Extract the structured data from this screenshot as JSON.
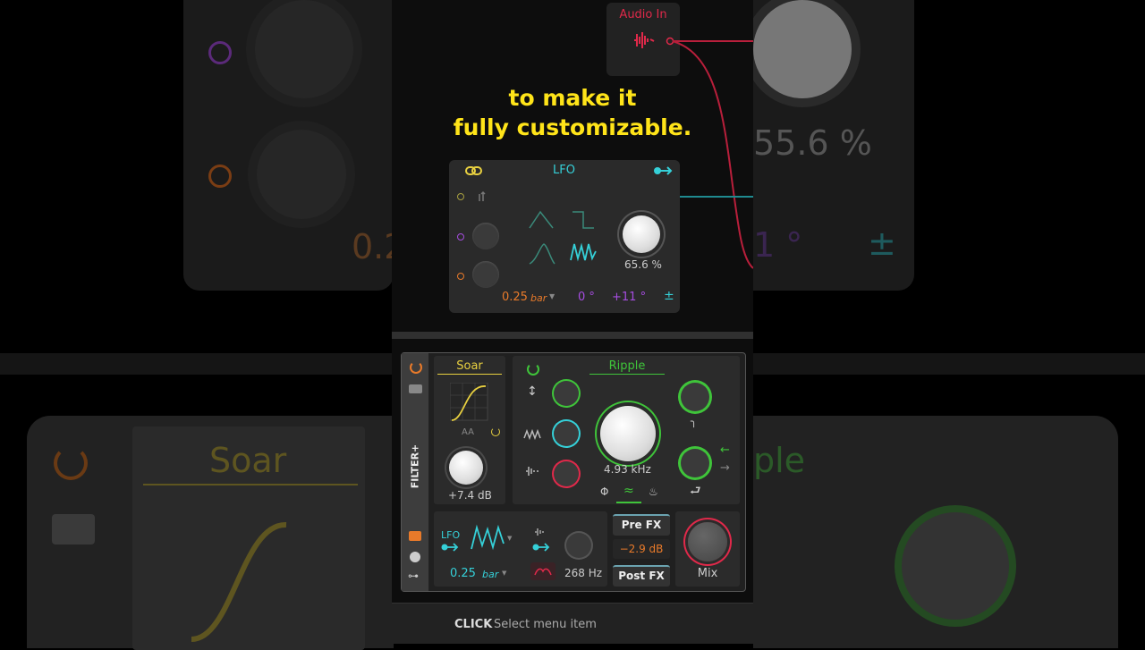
{
  "caption": {
    "line1": "to make it",
    "line2": "fully customizable."
  },
  "background": {
    "right_percent": "55.6 %",
    "right_degrees": "1 °",
    "left_value": "0.2",
    "plus": "±",
    "soar": "Soar",
    "ripple_partial": "ple"
  },
  "audio_in": {
    "label": "Audio In"
  },
  "lfo_panel": {
    "title": "LFO",
    "amount": "65.6 %",
    "rate_value": "0.25",
    "rate_unit": "bar",
    "phase": "0 °",
    "offset": "+11 °",
    "plus_minus": "±"
  },
  "device": {
    "side_label": "FILTER+",
    "soar": {
      "title": "Soar",
      "aa": "AA",
      "gain": "+7.4 dB"
    },
    "ripple": {
      "title": "Ripple",
      "frequency": "4.93 kHz"
    },
    "mod": {
      "source": "LFO",
      "rate_value": "0.25",
      "rate_unit": "bar",
      "cutoff": "268 Hz"
    },
    "fx": {
      "pre": "Pre FX",
      "level": "−2.9 dB",
      "post": "Post FX"
    },
    "mix": "Mix"
  },
  "status_bar": {
    "action": "CLICK",
    "description": "Select menu item"
  },
  "colors": {
    "accent_yellow": "#ffe419",
    "audio_red": "#e0294a",
    "lfo_cyan": "#35d0d8",
    "ripple_green": "#3fc43a",
    "soar_yellow": "#e8d040",
    "orange": "#e87a2a",
    "purple": "#a64de0"
  }
}
